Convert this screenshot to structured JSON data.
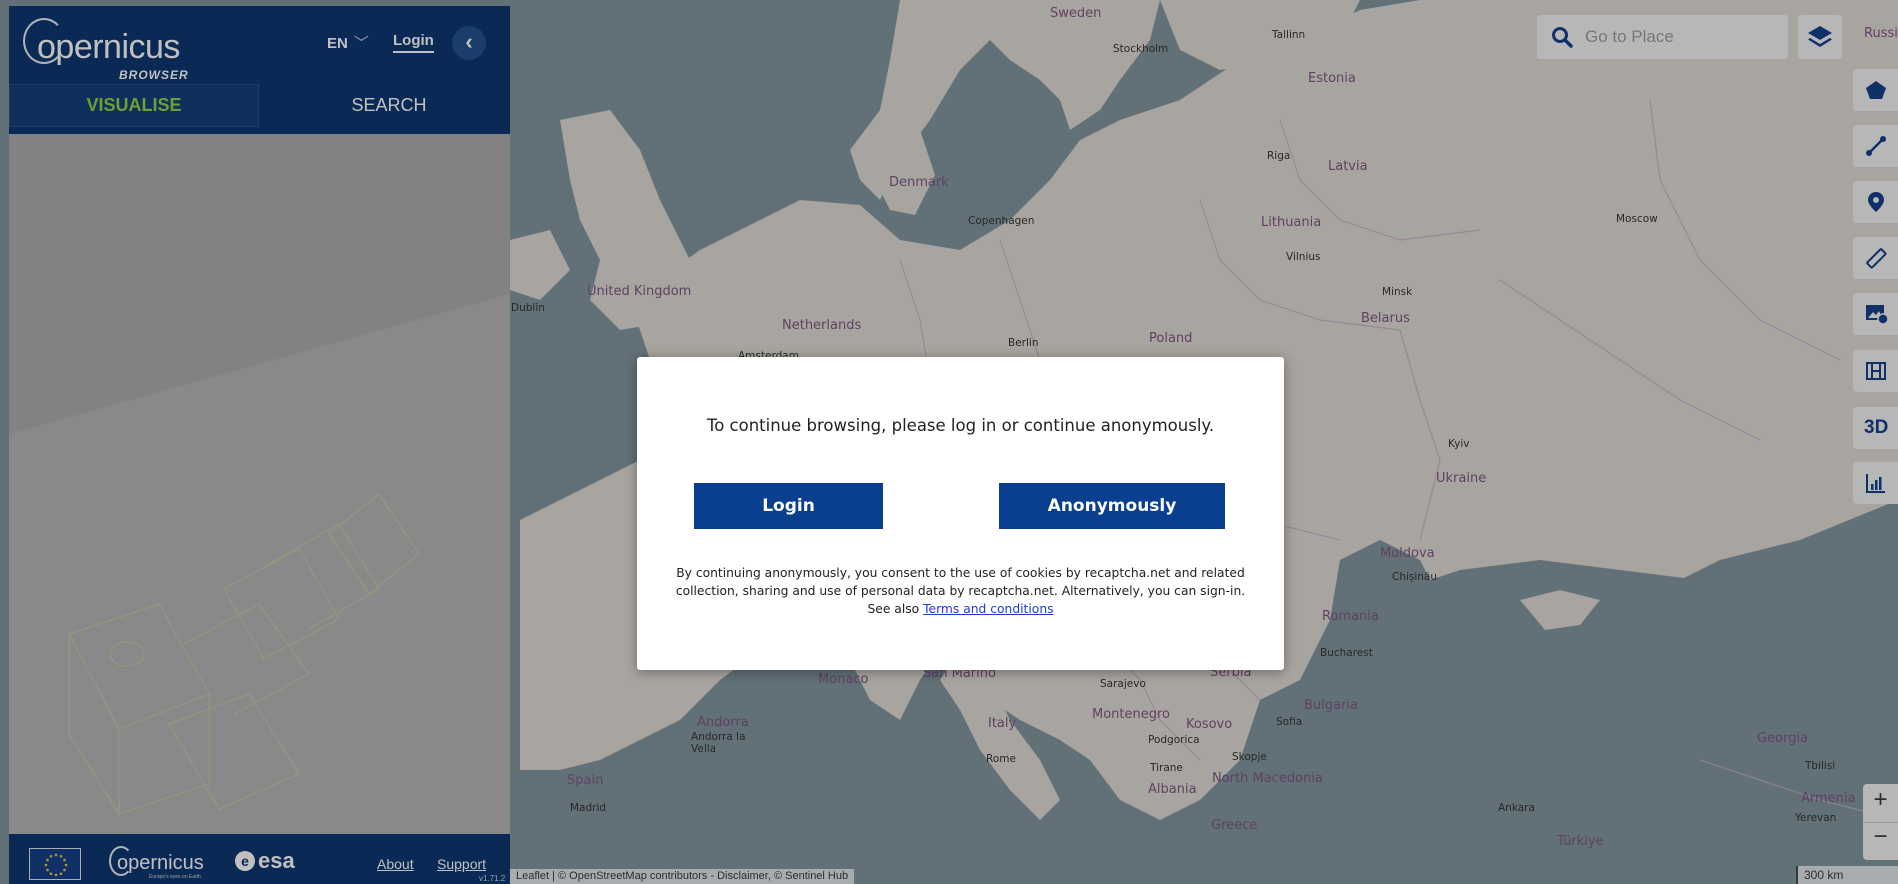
{
  "sidebar": {
    "logo_word": "opernicus",
    "logo_sub": "BROWSER",
    "language": "EN",
    "login_label": "Login",
    "collapse_glyph": "‹",
    "tabs": [
      {
        "label": "VISUALISE",
        "active": true
      },
      {
        "label": "SEARCH",
        "active": false
      }
    ],
    "footer": {
      "copernicus_word": "opernicus",
      "copernicus_tag": "Europe's eyes on Earth",
      "esa_word": "esa",
      "about_label": "About",
      "support_label": "Support",
      "version": "v1.71.2"
    }
  },
  "map": {
    "search_placeholder": "Go to Place",
    "country_labels": [
      "Sweden",
      "Estonia",
      "Latvia",
      "Lithuania",
      "Belarus",
      "Poland",
      "Ukraine",
      "Moldova",
      "Romania",
      "Bulgaria",
      "Denmark",
      "United Kingdom",
      "Netherlands",
      "Serbia",
      "Montenegro",
      "Kosovo",
      "North Macedonia",
      "Albania",
      "Greece",
      "Italy",
      "Monaco",
      "San Marino",
      "Andorra",
      "Spain",
      "Georgia",
      "Armenia",
      "Türkiye",
      "Russi"
    ],
    "city_labels": [
      "Stockholm",
      "Tallinn",
      "Riga",
      "Copenhagen",
      "Vilnius",
      "Minsk",
      "Moscow",
      "Berlin",
      "Kyiv",
      "Chișinău",
      "Bucharest",
      "Sofia",
      "Sarajevo",
      "Podgorica",
      "Skopje",
      "Tirane",
      "Rome",
      "Andorra la Vella",
      "Madrid",
      "Ankara",
      "Tbilisi",
      "Yerevan",
      "Dublin",
      "Amsterdam"
    ],
    "tools": [
      "polygon-icon",
      "line-icon",
      "marker-icon",
      "ruler-icon",
      "image-info-icon",
      "film-icon",
      "3D",
      "histogram-icon"
    ],
    "zoom_in": "+",
    "zoom_out": "−",
    "scale": "300 km",
    "attribution": "Leaflet | © OpenStreetMap contributors - Disclaimer, © Sentinel Hub"
  },
  "modal": {
    "message": "To continue browsing, please log in or continue anonymously.",
    "login_button": "Login",
    "anonymous_button": "Anonymously",
    "consent_text": "By continuing anonymously, you consent to the use of cookies by recaptcha.net and related collection, sharing and use of personal data by recaptcha.net. Alternatively, you can sign-in. See also ",
    "terms_link": "Terms and conditions"
  },
  "colors": {
    "brand_blue": "#052f6b",
    "button_blue": "#0a3e8f",
    "active_tab_text": "#8fd13a",
    "sea": "#7b8f99",
    "land": "#ded9d2"
  }
}
